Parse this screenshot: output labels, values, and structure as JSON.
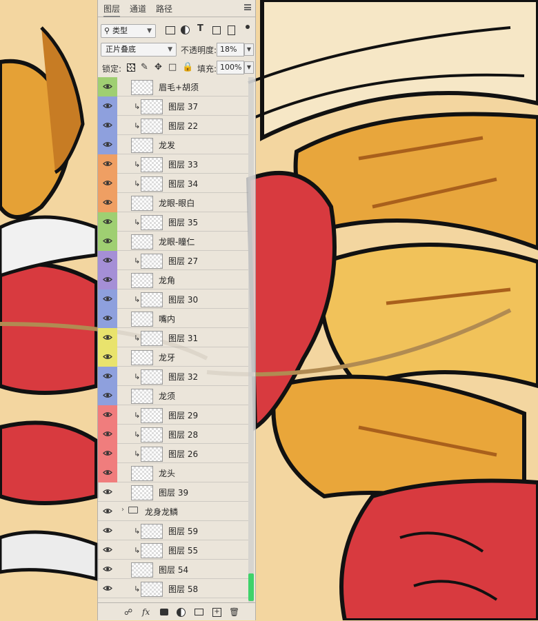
{
  "panel": {
    "tabs": [
      {
        "label": "图层",
        "active": true
      },
      {
        "label": "通道",
        "active": false
      },
      {
        "label": "路径",
        "active": false
      }
    ],
    "filter_label": "类型",
    "blend_mode": "正片叠底",
    "opacity_label": "不透明度:",
    "opacity_value": "18%",
    "lock_label": "锁定:",
    "fill_label": "填充:",
    "fill_value": "100%",
    "layers": [
      {
        "name": "眉毛+胡须",
        "color": "#9fcf72",
        "clip": false,
        "folder": false
      },
      {
        "name": "图层 37",
        "color": "#8ea0dd",
        "clip": true,
        "folder": false
      },
      {
        "name": "图层 22",
        "color": "#8ea0dd",
        "clip": true,
        "folder": false
      },
      {
        "name": "龙发",
        "color": "#8ea0dd",
        "clip": false,
        "folder": false
      },
      {
        "name": "图层 33",
        "color": "#ef9f63",
        "clip": true,
        "folder": false
      },
      {
        "name": "图层 34",
        "color": "#ef9f63",
        "clip": true,
        "folder": false
      },
      {
        "name": "龙眼-眼白",
        "color": "#ef9f63",
        "clip": false,
        "folder": false
      },
      {
        "name": "图层 35",
        "color": "#9fcf72",
        "clip": true,
        "folder": false
      },
      {
        "name": "龙眼-瞳仁",
        "color": "#9fcf72",
        "clip": false,
        "folder": false
      },
      {
        "name": "图层 27",
        "color": "#a58fd6",
        "clip": true,
        "folder": false
      },
      {
        "name": "龙角",
        "color": "#a58fd6",
        "clip": false,
        "folder": false
      },
      {
        "name": "图层 30",
        "color": "#8ea0dd",
        "clip": true,
        "folder": false
      },
      {
        "name": "嘴内",
        "color": "#8ea0dd",
        "clip": false,
        "folder": false
      },
      {
        "name": "图层 31",
        "color": "#e9e36d",
        "clip": true,
        "folder": false
      },
      {
        "name": "龙牙",
        "color": "#e9e36d",
        "clip": false,
        "folder": false
      },
      {
        "name": "图层 32",
        "color": "#8ea0dd",
        "clip": true,
        "folder": false
      },
      {
        "name": "龙须",
        "color": "#8ea0dd",
        "clip": false,
        "folder": false
      },
      {
        "name": "图层 29",
        "color": "#f07d7d",
        "clip": true,
        "folder": false
      },
      {
        "name": "图层 28",
        "color": "#f07d7d",
        "clip": true,
        "folder": false
      },
      {
        "name": "图层 26",
        "color": "#f07d7d",
        "clip": true,
        "folder": false
      },
      {
        "name": "龙头",
        "color": "#f07d7d",
        "clip": false,
        "folder": false
      },
      {
        "name": "图层 39",
        "color": "",
        "clip": false,
        "folder": false
      },
      {
        "name": "龙身龙鳞",
        "color": "",
        "clip": false,
        "folder": true
      },
      {
        "name": "图层 59",
        "color": "",
        "clip": true,
        "folder": false
      },
      {
        "name": "图层 55",
        "color": "",
        "clip": true,
        "folder": false
      },
      {
        "name": "图层 54",
        "color": "",
        "clip": false,
        "folder": false
      },
      {
        "name": "图层 58",
        "color": "",
        "clip": true,
        "folder": false
      }
    ]
  }
}
